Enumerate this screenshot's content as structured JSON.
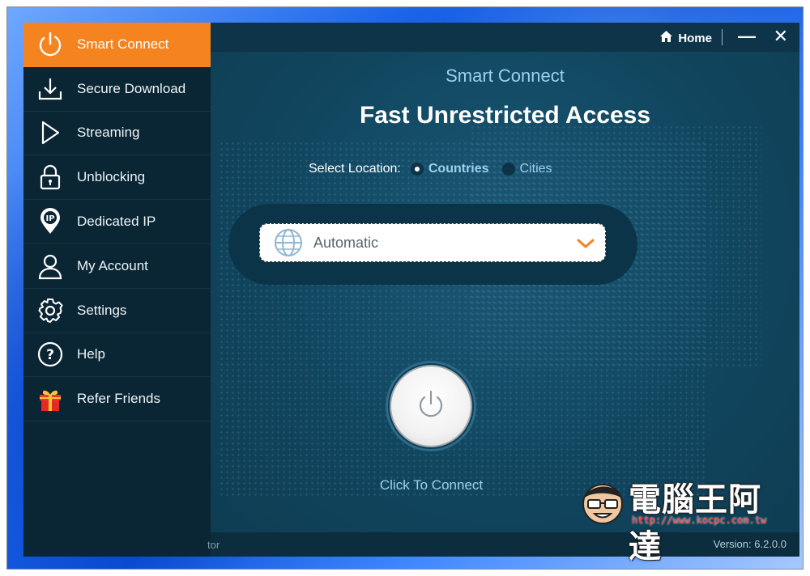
{
  "sidebar": {
    "items": [
      {
        "label": "Smart Connect",
        "icon": "power-icon",
        "active": true
      },
      {
        "label": "Secure Download",
        "icon": "download-icon"
      },
      {
        "label": "Streaming",
        "icon": "play-icon"
      },
      {
        "label": "Unblocking",
        "icon": "lock-icon"
      },
      {
        "label": "Dedicated IP",
        "icon": "ip-pin-icon"
      },
      {
        "label": "My Account",
        "icon": "user-icon"
      },
      {
        "label": "Settings",
        "icon": "gear-icon"
      },
      {
        "label": "Help",
        "icon": "help-icon"
      },
      {
        "label": "Refer Friends",
        "icon": "gift-icon"
      }
    ]
  },
  "titlebar": {
    "home_label": "Home",
    "minimize_glyph": "—",
    "close_glyph": "✕"
  },
  "main": {
    "subtitle": "Smart Connect",
    "headline": "Fast Unrestricted Access",
    "location": {
      "label": "Select Location:",
      "options": [
        "Countries",
        "Cities"
      ],
      "selected": "Countries"
    },
    "dropdown": {
      "value": "Automatic"
    },
    "connect_label": "Click To Connect"
  },
  "statusbar": {
    "left_text": "tor",
    "version": "Version:  6.2.0.0"
  },
  "watermark": {
    "text": "電腦王阿達",
    "url": "http://www.kocpc.com.tw"
  },
  "colors": {
    "accent": "#f58320",
    "sidebar_bg": "#0a2533",
    "main_bg": "#11465f",
    "light_blue_text": "#9dd0ea"
  }
}
